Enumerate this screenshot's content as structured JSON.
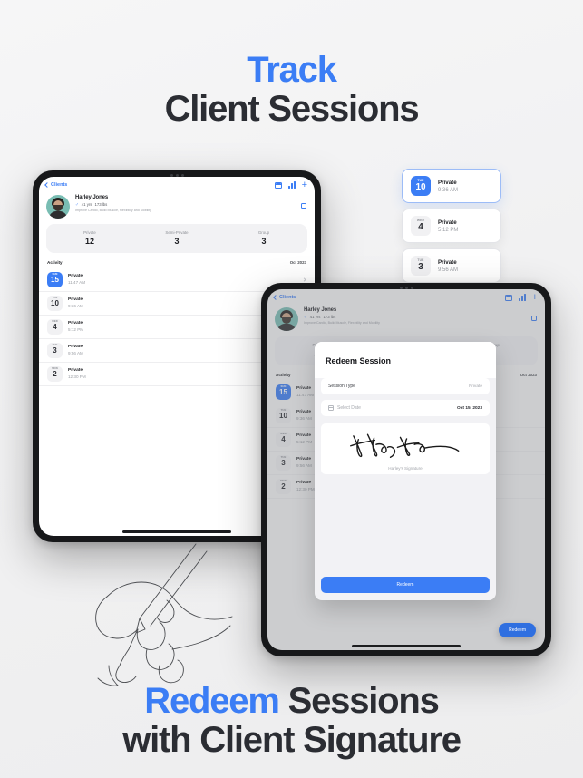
{
  "headline_top": {
    "accent": "Track",
    "line2": "Client Sessions"
  },
  "headline_bottom": {
    "accent": "Redeem",
    "rest": " Sessions",
    "line2": "with Client Signature"
  },
  "colors": {
    "accent": "#3B7DF5",
    "background": "#F2F2F2",
    "text_dark": "#2B2D33",
    "muted": "#9B9EA4"
  },
  "app": {
    "back_label": "Clients",
    "icons": [
      "note-icon",
      "bar-chart-icon",
      "plus-icon"
    ],
    "profile": {
      "name": "Harley Jones",
      "gender_icon": "male-icon",
      "age": "41 yrs",
      "weight": "173 lbs",
      "goals": "Improve Cardio, Build Muscle, Flexibility and Mobility"
    },
    "stats": [
      {
        "label": "Private",
        "value": "12"
      },
      {
        "label": "Semi-Private",
        "value": "3"
      },
      {
        "label": "Group",
        "value": "3"
      }
    ],
    "activity": {
      "title": "Activity",
      "month": "Oct 2023"
    },
    "sessions": [
      {
        "dow": "SUN",
        "day": "15",
        "type": "Private",
        "time": "11:47 AM",
        "active": true
      },
      {
        "dow": "TUE",
        "day": "10",
        "type": "Private",
        "time": "9:36 AM",
        "active": false
      },
      {
        "dow": "WED",
        "day": "4",
        "type": "Private",
        "time": "5:12 PM",
        "active": false
      },
      {
        "dow": "TUE",
        "day": "3",
        "type": "Private",
        "time": "9:56 AM",
        "active": false
      },
      {
        "dow": "MON",
        "day": "2",
        "type": "Private",
        "time": "12:30 PM",
        "active": false
      }
    ]
  },
  "float_cards": [
    {
      "dow": "TUE",
      "day": "10",
      "type": "Private",
      "time": "9:36 AM",
      "selected": true
    },
    {
      "dow": "WED",
      "day": "4",
      "type": "Private",
      "time": "5:12 PM",
      "selected": false
    },
    {
      "dow": "TUE",
      "day": "3",
      "type": "Private",
      "time": "9:56 AM",
      "selected": false
    }
  ],
  "modal": {
    "title": "Redeem Session",
    "session_type_label": "Session Type",
    "session_type_value": "Private",
    "date_placeholder": "Select Date",
    "date_value": "Oct 15, 2023",
    "signature_caption": "Harley's Signature",
    "redeem_button": "Redeem"
  },
  "fab": {
    "label": "Redeem"
  }
}
